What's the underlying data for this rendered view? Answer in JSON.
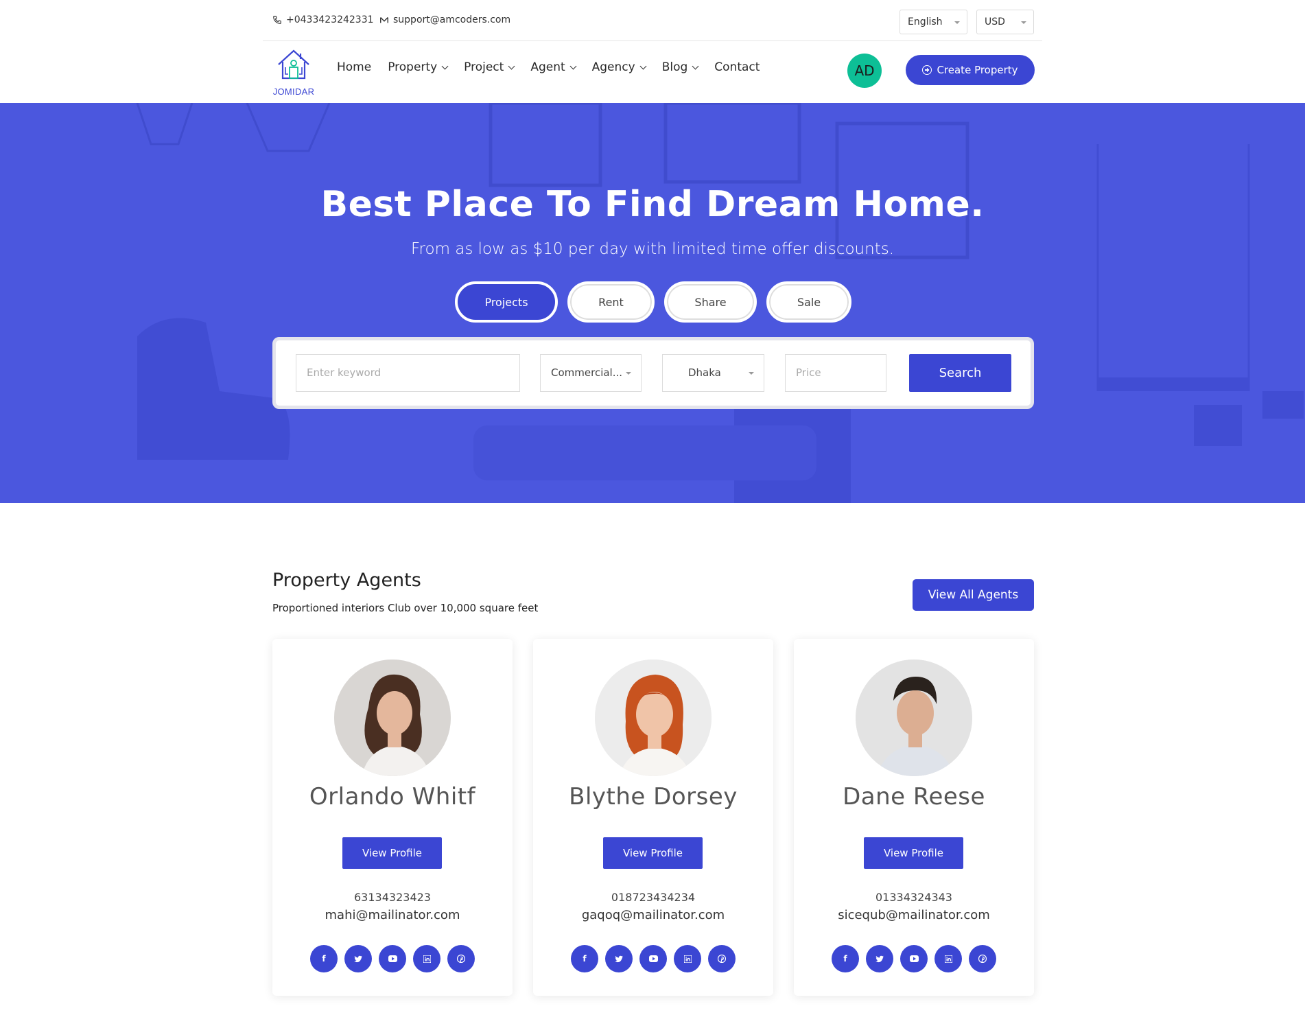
{
  "topbar": {
    "phone": "+0433423242331",
    "email": "support@amcoders.com",
    "language": "English",
    "currency": "USD"
  },
  "nav": {
    "logo_text": "JOMIDAR",
    "items": [
      {
        "label": "Home",
        "dropdown": false
      },
      {
        "label": "Property",
        "dropdown": true
      },
      {
        "label": "Project",
        "dropdown": true
      },
      {
        "label": "Agent",
        "dropdown": true
      },
      {
        "label": "Agency",
        "dropdown": true
      },
      {
        "label": "Blog",
        "dropdown": true
      },
      {
        "label": "Contact",
        "dropdown": false
      }
    ],
    "avatar_initials": "AD",
    "create_label": "Create Property"
  },
  "hero": {
    "title": "Best Place To Find Dream Home.",
    "subtitle": "From as low as $10 per day with limited time offer discounts.",
    "tabs": [
      "Projects",
      "Rent",
      "Share",
      "Sale"
    ],
    "active_tab": "Projects",
    "search": {
      "keyword_placeholder": "Enter keyword",
      "category_value": "Commercial...",
      "city_value": "Dhaka",
      "price_placeholder": "Price",
      "button_label": "Search"
    }
  },
  "agents_section": {
    "title": "Property Agents",
    "subtitle": "Proportioned interiors Club over 10,000 square feet",
    "view_all_label": "View All Agents",
    "agents": [
      {
        "name": "Orlando Whitf",
        "button": "View Profile",
        "phone": "63134323423",
        "email": "mahi@mailinator.com"
      },
      {
        "name": "Blythe Dorsey",
        "button": "View Profile",
        "phone": "018723434234",
        "email": "gaqoq@mailinator.com"
      },
      {
        "name": "Dane Reese",
        "button": "View Profile",
        "phone": "01334324343",
        "email": "sicequb@mailinator.com"
      }
    ],
    "social_icons": [
      "facebook-icon",
      "twitter-icon",
      "youtube-icon",
      "linkedin-icon",
      "pinterest-icon"
    ]
  },
  "colors": {
    "accent": "#3b46d3",
    "hero_overlay": "#4b57de",
    "avatar": "#0dbf96"
  }
}
